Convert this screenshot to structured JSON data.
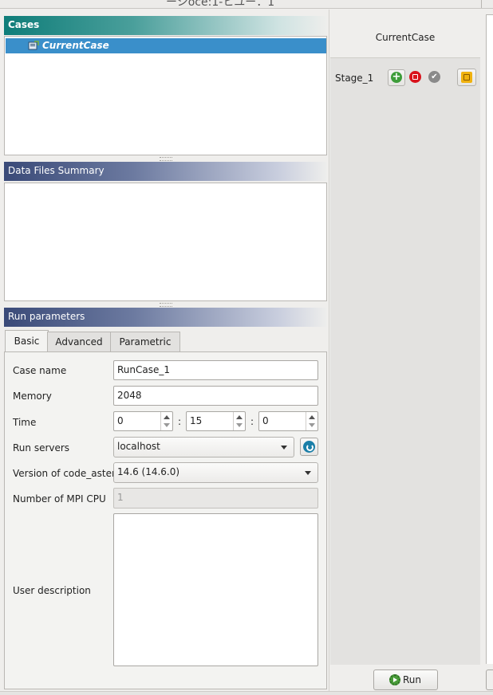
{
  "window": {
    "title_fragment": "ーシoce:1-ヒユー：1"
  },
  "cases": {
    "header": "Cases",
    "items": [
      {
        "label": "CurrentCase",
        "selected": true
      }
    ]
  },
  "data_files": {
    "header": "Data Files Summary"
  },
  "run_parameters": {
    "header": "Run parameters",
    "tabs": [
      {
        "label": "Basic",
        "active": true
      },
      {
        "label": "Advanced",
        "active": false
      },
      {
        "label": "Parametric",
        "active": false
      }
    ],
    "labels": {
      "case_name": "Case name",
      "memory": "Memory",
      "time": "Time",
      "run_servers": "Run servers",
      "version": "Version of code_aster",
      "mpi_cpu": "Number of MPI CPU",
      "user_description": "User description"
    },
    "values": {
      "case_name": "RunCase_1",
      "memory": "2048",
      "time_h": "0",
      "time_m": "15",
      "time_s": "0",
      "time_sep": ":",
      "run_server": "localhost",
      "version": "14.6 (14.6.0)",
      "mpi_cpu": "1",
      "user_description": ""
    }
  },
  "stages_panel": {
    "title": "CurrentCase",
    "stages": [
      {
        "label": "Stage_1"
      }
    ],
    "run_label": "Run"
  },
  "colors": {
    "cases_header": "#0f7d79",
    "section_header": "#3a4a78",
    "selection": "#3a8fca",
    "stop_icon": "#d9131c",
    "add_icon": "#3e9d3a",
    "tag_icon": "#f0b20f"
  }
}
